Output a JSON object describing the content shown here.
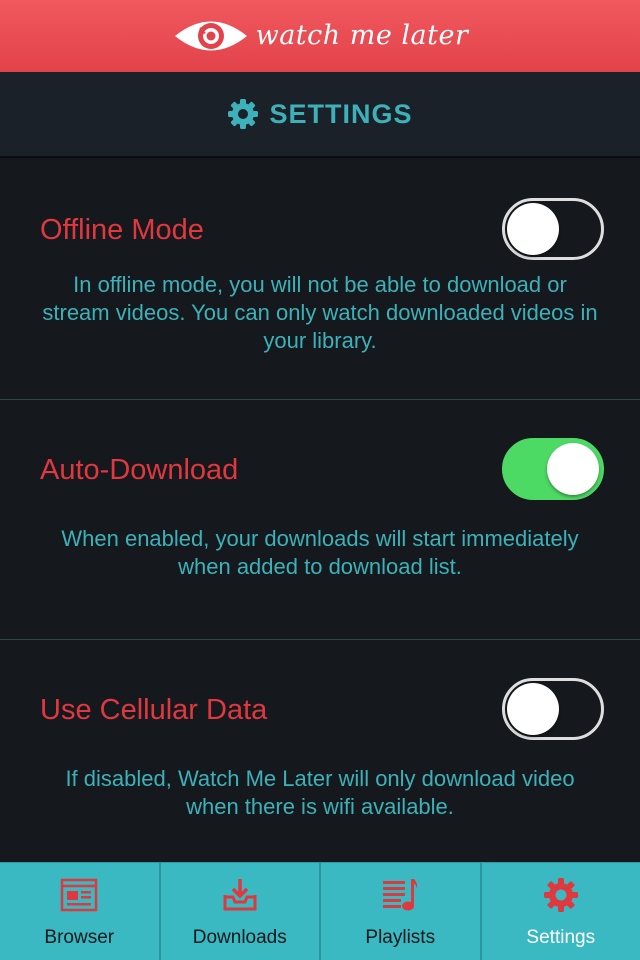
{
  "header": {
    "logo_text": "watch me later",
    "icon": "eye-logo-icon",
    "bg_color": "#e84a51"
  },
  "title_bar": {
    "icon": "gear-icon",
    "title": "SETTINGS",
    "accent_color": "#3cb1b9"
  },
  "settings": [
    {
      "label": "Offline Mode",
      "description": "In offline mode, you will not be able to download or stream videos. You can only watch downloaded videos in your library.",
      "enabled": false
    },
    {
      "label": "Auto-Download",
      "description": "When enabled, your downloads will start immediately when added to download list.",
      "enabled": true
    },
    {
      "label": "Use Cellular Data",
      "description": "If disabled, Watch Me Later will only download video when there is wifi available.",
      "enabled": false
    }
  ],
  "tabs": [
    {
      "label": "Browser",
      "icon": "browser-icon",
      "active": false
    },
    {
      "label": "Downloads",
      "icon": "downloads-icon",
      "active": false
    },
    {
      "label": "Playlists",
      "icon": "playlists-icon",
      "active": false
    },
    {
      "label": "Settings",
      "icon": "settings-gear-icon",
      "active": true
    }
  ],
  "colors": {
    "label_red": "#e0383f",
    "toggle_on": "#4cd964",
    "tab_bar": "#3ab9c2"
  }
}
